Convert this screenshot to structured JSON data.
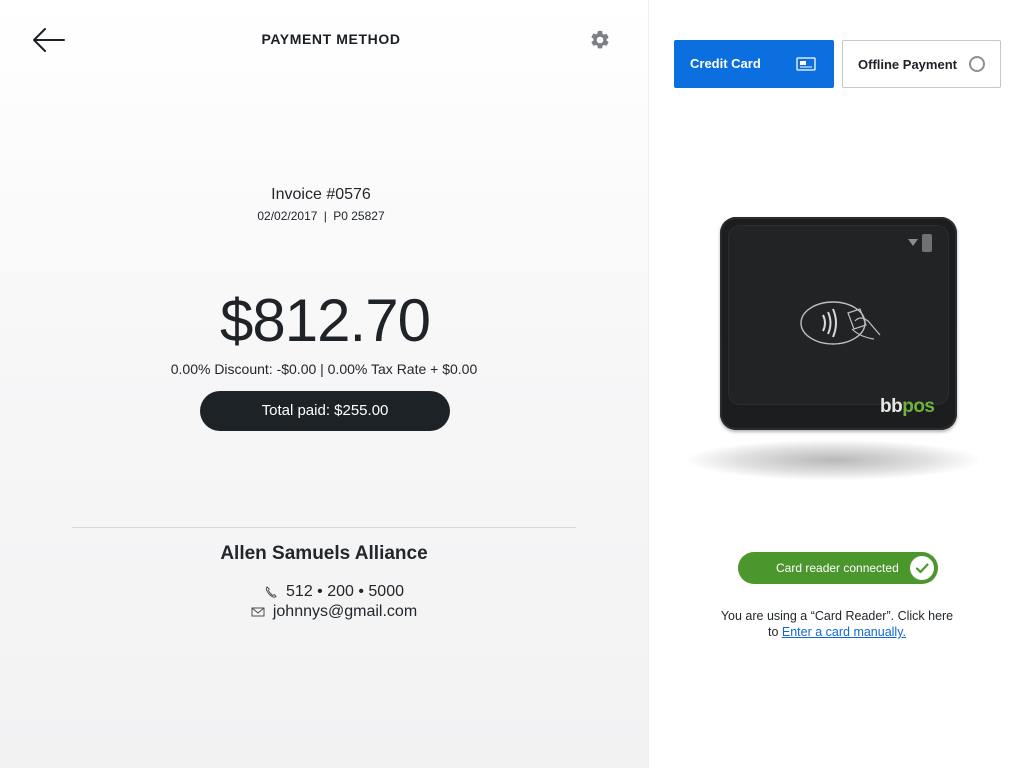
{
  "header": {
    "title": "PAYMENT METHOD",
    "back_icon": "arrow-left-icon",
    "settings_icon": "gear-icon"
  },
  "invoice": {
    "title": "Invoice #0576",
    "date": "02/02/2017",
    "separator": "|",
    "po": "P0 25827"
  },
  "amount": {
    "value": "$812.70",
    "discount_line": "0.00% Discount: -$0.00 | 0.00% Tax Rate + $0.00",
    "total_paid": "Total paid: $255.00"
  },
  "customer": {
    "name": "Allen Samuels Alliance",
    "phone": "512 • 200 • 5000",
    "email": "johnnys@gmail.com"
  },
  "payment_tabs": {
    "credit_card": "Credit Card",
    "offline": "Offline Payment",
    "credit_icon": "card-icon",
    "offline_icon": "radio-empty-icon"
  },
  "reader": {
    "brand_bb": "bb",
    "brand_pos": "pos"
  },
  "status": {
    "text": "Card reader connected",
    "icon": "check-icon"
  },
  "helper": {
    "line1": "You are using a “Card Reader”. Click here",
    "prefix": "to ",
    "link": "Enter a card manually."
  },
  "colors": {
    "accent": "#0b6fdf",
    "success": "#4c962e",
    "dark_pill": "#1c2226",
    "brand_green": "#6fb33a",
    "link": "#1168cf"
  }
}
